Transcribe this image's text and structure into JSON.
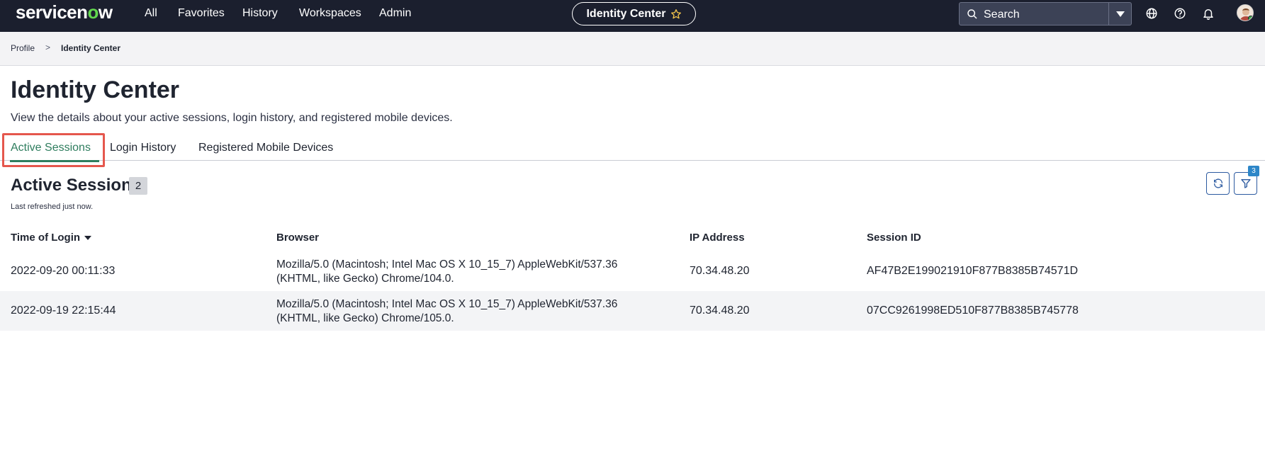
{
  "brand": {
    "name_part1": "servicen",
    "name_o": "o",
    "name_part2": "w"
  },
  "nav": {
    "items": [
      "All",
      "Favorites",
      "History",
      "Workspaces",
      "Admin"
    ]
  },
  "context_pill": {
    "label": "Identity Center",
    "icon": "star-icon"
  },
  "search": {
    "placeholder": "Search"
  },
  "top_icons": [
    "globe-icon",
    "help-icon",
    "bell-icon"
  ],
  "breadcrumb": {
    "items": [
      "Profile",
      "Identity Center"
    ],
    "separator": ">"
  },
  "page": {
    "title": "Identity Center",
    "description": "View the details about your active sessions, login history, and registered mobile devices."
  },
  "tabs": [
    {
      "label": "Active Sessions",
      "active": true
    },
    {
      "label": "Login History",
      "active": false
    },
    {
      "label": "Registered Mobile Devices",
      "active": false
    }
  ],
  "section": {
    "title": "Active Sessions",
    "count": "2",
    "last_refreshed": "Last refreshed just now.",
    "filter_count": "3"
  },
  "table": {
    "columns": [
      "Time of Login",
      "Browser",
      "IP Address",
      "Session ID"
    ],
    "sorted_column": "Time of Login",
    "rows": [
      {
        "time": "2022-09-20 00:11:33",
        "browser_line1": "Mozilla/5.0 (Macintosh; Intel Mac OS X 10_15_7) AppleWebKit/537.36",
        "browser_line2": "(KHTML, like Gecko) Chrome/104.0.",
        "ip": "70.34.48.20",
        "session_id": "AF47B2E199021910F877B8385B74571D"
      },
      {
        "time": "2022-09-19 22:15:44",
        "browser_line1": "Mozilla/5.0 (Macintosh; Intel Mac OS X 10_15_7) AppleWebKit/537.36",
        "browser_line2": "(KHTML, like Gecko) Chrome/105.0.",
        "ip": "70.34.48.20",
        "session_id": "07CC9261998ED510F877B8385B745778"
      }
    ]
  },
  "colors": {
    "topbar": "#1b1f2e",
    "active_tab": "#2e7d5e",
    "highlight": "#e5574d",
    "icon_button_border": "#2c5aa0",
    "logo_accent": "#62d84e"
  }
}
